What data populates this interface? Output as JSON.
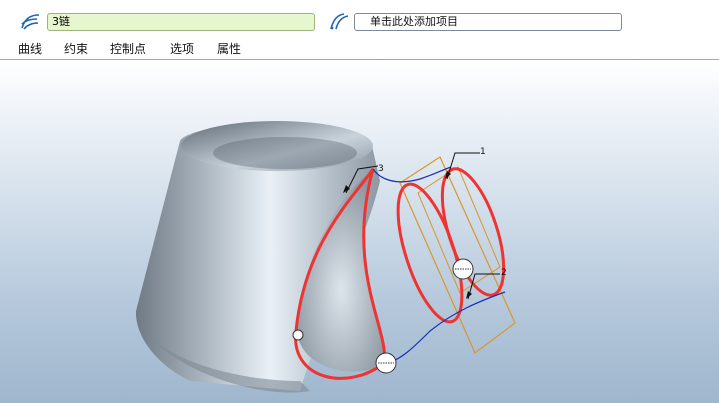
{
  "toolbar": {
    "name_value": "3链",
    "reference_placeholder": "单击此处添加项目",
    "curve_icon": "curve-icon",
    "reference_icon": "reference-curve-icon"
  },
  "menu": {
    "items": [
      "曲线",
      "约束",
      "控制点",
      "选项",
      "属性"
    ]
  },
  "scene": {
    "labels": [
      "1",
      "2",
      "3"
    ],
    "colors": {
      "curve_red": "#ee3333",
      "curve_blue": "#1a2fb8",
      "plane_orange": "#d9962b",
      "body_gray": "#8f9aa4"
    }
  }
}
